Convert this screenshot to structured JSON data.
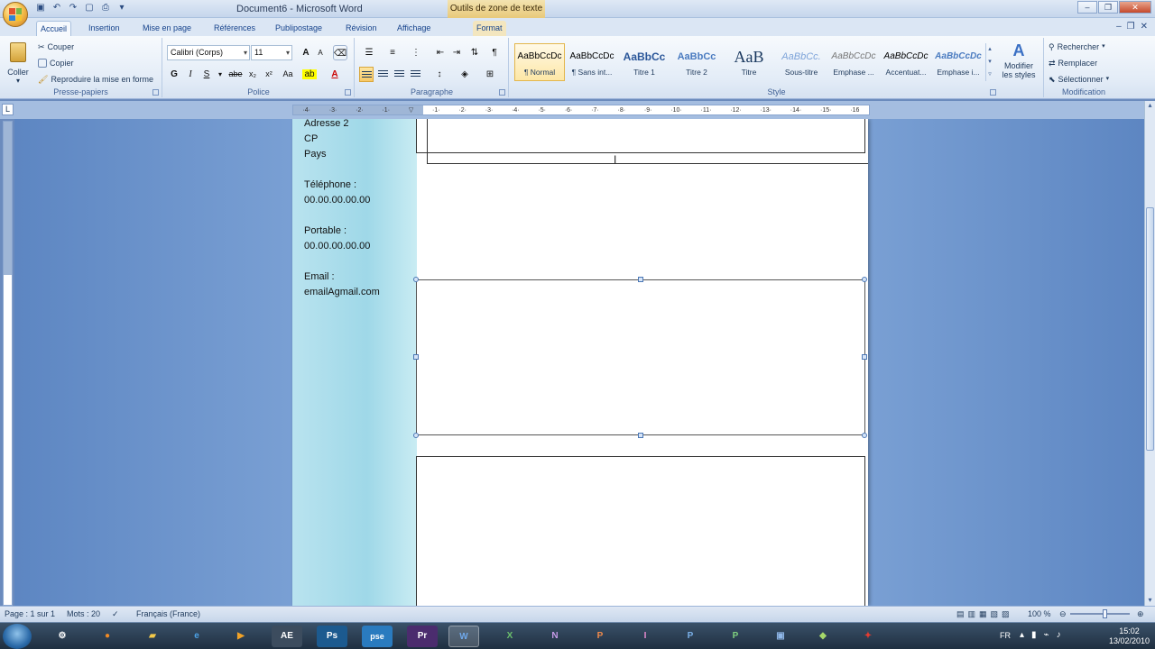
{
  "window": {
    "title": "Document6 - Microsoft Word",
    "context_tab_title": "Outils de zone de texte"
  },
  "tabs": [
    "Accueil",
    "Insertion",
    "Mise en page",
    "Références",
    "Publipostage",
    "Révision",
    "Affichage",
    "Format"
  ],
  "clipboard": {
    "paste_label": "Coller",
    "cut_label": "Couper",
    "copy_label": "Copier",
    "format_painter_label": "Reproduire la mise en forme",
    "group_label": "Presse-papiers"
  },
  "font": {
    "font_name": "Calibri (Corps)",
    "font_size": "11",
    "bold": "G",
    "italic": "I",
    "underline": "S",
    "strike": "abe",
    "subscript": "x₂",
    "superscript": "x²",
    "case": "Aa",
    "grow": "A",
    "shrink": "A",
    "group_label": "Police"
  },
  "paragraph": {
    "group_label": "Paragraphe"
  },
  "styles": {
    "items": [
      {
        "sample": "AaBbCcDc",
        "name": "¶ Normal"
      },
      {
        "sample": "AaBbCcDc",
        "name": "¶ Sans int..."
      },
      {
        "sample": "AaBbCc",
        "name": "Titre 1"
      },
      {
        "sample": "AaBbCc",
        "name": "Titre 2"
      },
      {
        "sample": "AaB",
        "name": "Titre"
      },
      {
        "sample": "AaBbCc.",
        "name": "Sous-titre"
      },
      {
        "sample": "AaBbCcDc",
        "name": "Emphase ..."
      },
      {
        "sample": "AaBbCcDc",
        "name": "Accentuat..."
      },
      {
        "sample": "AaBbCcDc",
        "name": "Emphase i..."
      }
    ],
    "change_styles_label_1": "Modifier",
    "change_styles_label_2": "les styles",
    "group_label": "Style"
  },
  "editing": {
    "find_label": "Rechercher",
    "replace_label": "Remplacer",
    "select_label": "Sélectionner",
    "group_label": "Modification"
  },
  "document": {
    "sidebar_lines": [
      "Adresse 2",
      "CP",
      "Pays",
      "Téléphone :",
      "00.00.00.00.00",
      "Portable :",
      "00.00.00.00.00",
      "Email :",
      "emailAgmail.com"
    ]
  },
  "status": {
    "page": "Page : 1 sur 1",
    "words": "Mots : 20",
    "language": "Français (France)",
    "zoom": "100 %"
  },
  "taskbar": {
    "apps": [
      "firefox-icon",
      "folder-icon",
      "ie-icon",
      "media-icon",
      "after-effects-icon",
      "photoshop-icon",
      "photoshop-elements-icon",
      "premiere-icon",
      "word-icon",
      "excel-icon",
      "onenote-icon",
      "powerpoint-icon",
      "publisher-icon",
      "visio-icon",
      "project-icon",
      "infopath-icon",
      "groove-icon",
      "acrobat-icon"
    ],
    "ae_label": "AE",
    "ps_label": "Ps",
    "pse_label": "pse",
    "pr_label": "Pr",
    "language": "FR",
    "time": "15:02",
    "date": "13/02/2010"
  },
  "colors": {
    "accent": "#15428b",
    "sidebar": "#9fd8e8",
    "workspace": "#7aa0d4"
  }
}
